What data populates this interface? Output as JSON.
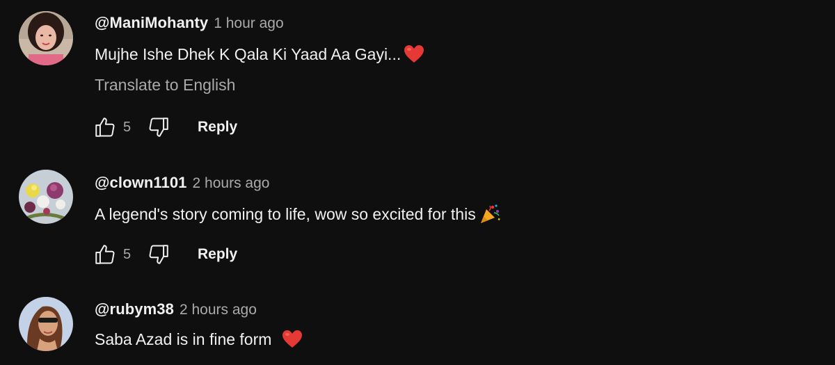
{
  "comments": [
    {
      "author": "@ManiMohanty",
      "time": "1 hour ago",
      "text": "Mujhe Ishe Dhek K Qala Ki Yaad Aa Gayi...",
      "emoji": "red-heart",
      "translate_label": "Translate to English",
      "likes": "5",
      "reply_label": "Reply"
    },
    {
      "author": "@clown1101",
      "time": "2 hours ago",
      "text": "A legend's story coming to life, wow so excited for this",
      "emoji": "party-popper",
      "likes": "5",
      "reply_label": "Reply"
    },
    {
      "author": "@rubym38",
      "time": "2 hours ago",
      "text": "Saba Azad is in fine form ",
      "emoji": "red-heart"
    }
  ],
  "colors": {
    "background": "#0f0f0f",
    "primary_text": "#f1f1f1",
    "secondary_text": "#aaaaaa",
    "heart": "#e53935"
  }
}
